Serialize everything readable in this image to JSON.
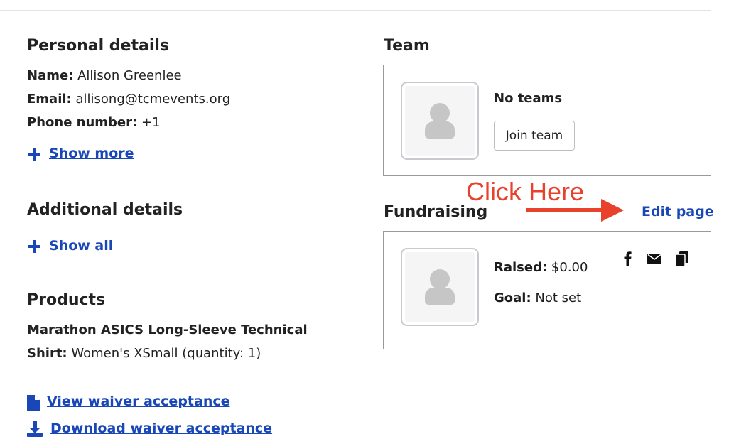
{
  "personal": {
    "title": "Personal details",
    "name_label": "Name:",
    "name_value": "Allison Greenlee",
    "email_label": "Email:",
    "email_value": "allisong@tcmevents.org",
    "phone_label": "Phone number:",
    "phone_value": "+1",
    "show_more": "Show more"
  },
  "additional": {
    "title": "Additional details",
    "show_all": "Show all"
  },
  "products": {
    "title": "Products",
    "item_line1": "Marathon ASICS Long-Sleeve Technical",
    "item_line2_label": "Shirt:",
    "item_line2_value": "Women's XSmall (quantity: 1)"
  },
  "waiver": {
    "view": "View waiver acceptance",
    "download": "Download waiver acceptance"
  },
  "team": {
    "title": "Team",
    "status": "No teams",
    "join_button": "Join team"
  },
  "fundraising": {
    "title": "Fundraising",
    "edit_link": "Edit page",
    "raised_label": "Raised:",
    "raised_value": "$0.00",
    "goal_label": "Goal:",
    "goal_value": "Not set",
    "share_icons": [
      "facebook-icon",
      "email-icon",
      "copy-icon"
    ]
  },
  "annotation": {
    "text": "Click Here",
    "color": "#e8412c"
  },
  "colors": {
    "link": "#1a47b8",
    "text": "#222222",
    "border": "#9a9a9a"
  }
}
